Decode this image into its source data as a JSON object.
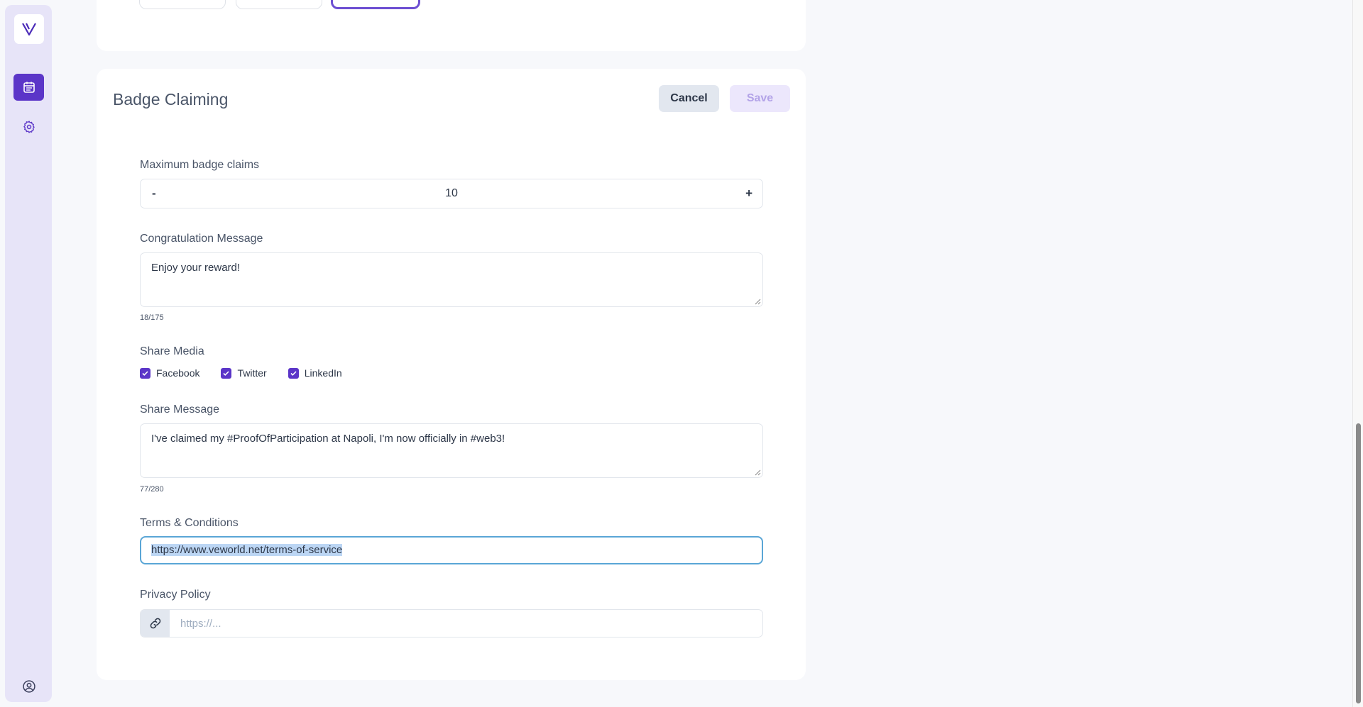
{
  "sidebar": {
    "logo_icon": "veworld-v-logo-icon",
    "items": [
      {
        "icon": "calendar-icon",
        "active": true
      },
      {
        "icon": "gear-icon",
        "active": false
      }
    ],
    "account_icon": "user-circle-icon",
    "accent_color": "#5b35c8"
  },
  "card": {
    "title": "Badge Claiming",
    "cancel_label": "Cancel",
    "save_label": "Save"
  },
  "max_claims": {
    "label": "Maximum badge claims",
    "decrement": "-",
    "value": "10",
    "increment": "+"
  },
  "congrats": {
    "label": "Congratulation Message",
    "value": "Enjoy your reward!",
    "counter": "18/175"
  },
  "share_media": {
    "label": "Share Media",
    "options": [
      {
        "label": "Facebook",
        "checked": true
      },
      {
        "label": "Twitter",
        "checked": true
      },
      {
        "label": "LinkedIn",
        "checked": true
      }
    ]
  },
  "share_message": {
    "label": "Share Message",
    "value": "I've claimed my #ProofOfParticipation at Napoli, I'm now officially in #web3!",
    "counter": "77/280"
  },
  "terms": {
    "label": "Terms & Conditions",
    "value": "https://www.veworld.net/terms-of-service"
  },
  "privacy": {
    "label": "Privacy Policy",
    "placeholder": "https://...",
    "addon_icon": "link-icon"
  }
}
